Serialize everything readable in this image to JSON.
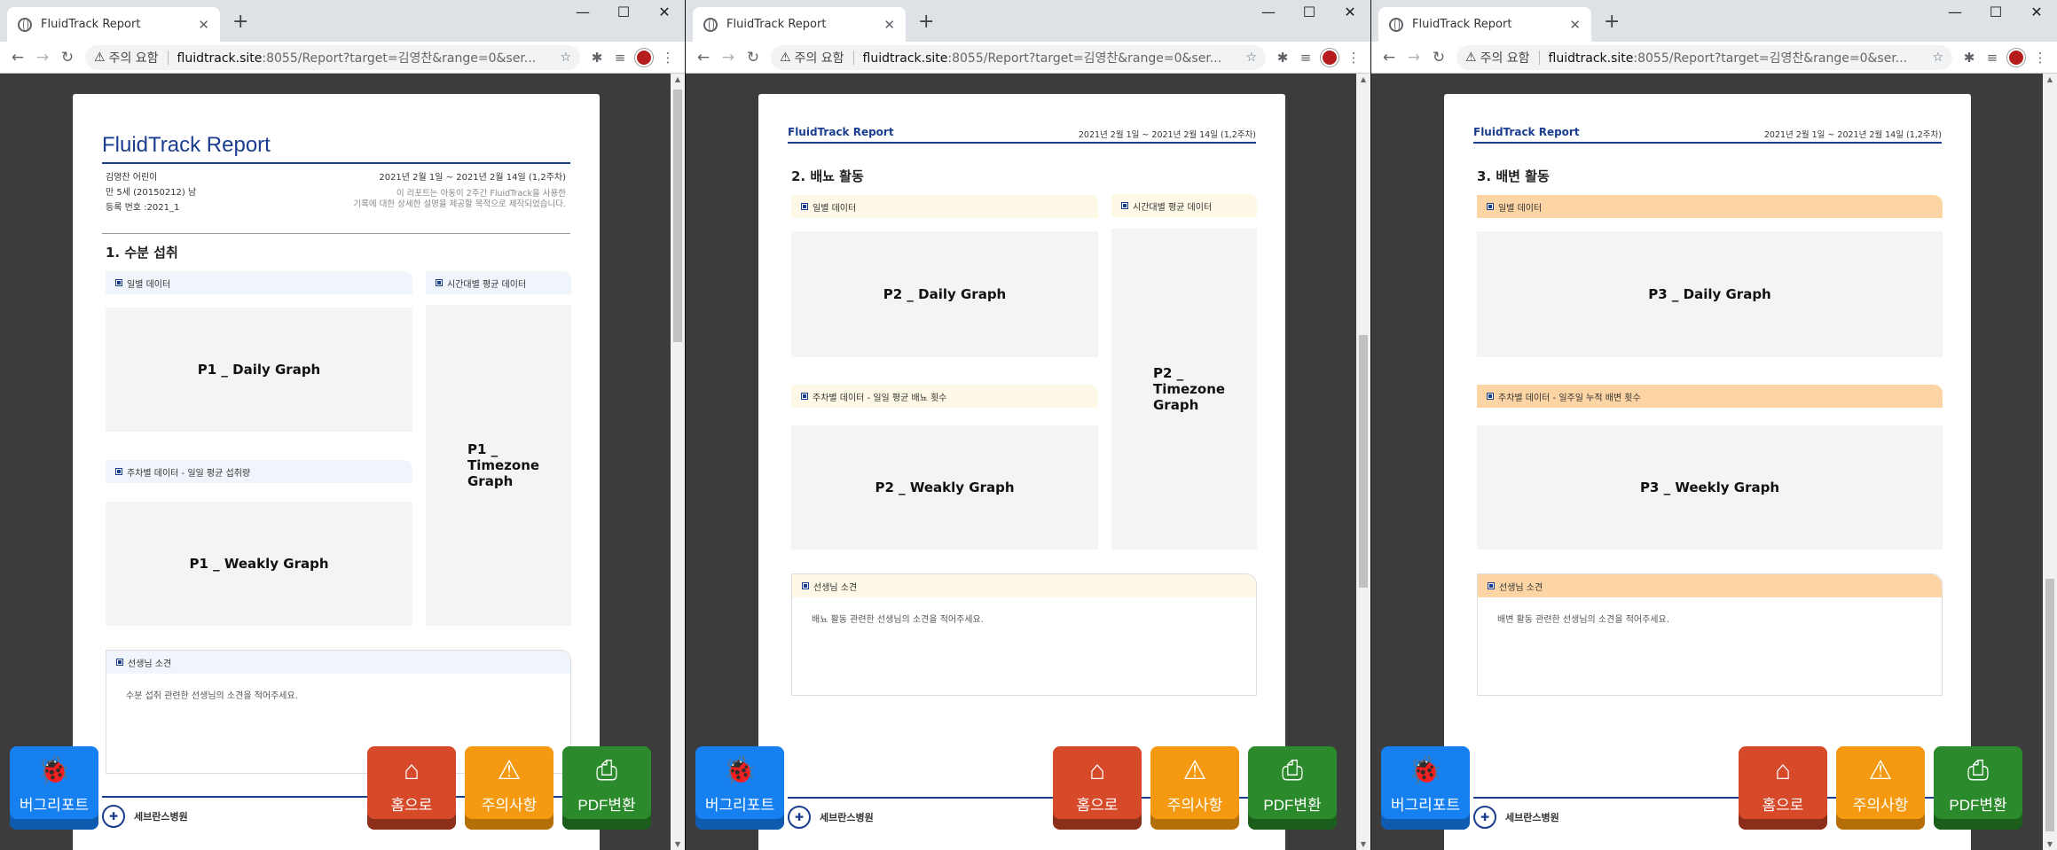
{
  "browser": {
    "tab_title": "FluidTrack Report",
    "tab_close": "✕",
    "new_tab": "+",
    "minimize": "—",
    "maximize": "☐",
    "close": "✕",
    "security_label": "주의 요함",
    "url_host": "fluidtrack.site",
    "url_rest": ":8055/Report?target=김영찬&range=0&ser..."
  },
  "report": {
    "title": "FluidTrack Report",
    "patient_name": "김영찬 어린이",
    "patient_age": "만 5세 (20150212) 남",
    "patient_id": "등록 번호 :2021_1",
    "date_range": "2021년 2월 1일 ~ 2021년 2월 14일 (1,2주차)",
    "note_line1": "이 리포트는 아동이 2주간 FluidTrack을 사용한",
    "note_line2": "기록에 대한 상세한 설명을 제공할 목적으로 제작되었습니다.",
    "mini_title": "FluidTrack Report",
    "hospital": "세브란스병원"
  },
  "page1": {
    "section_title": "1. 수분 섭취",
    "daily_label": "일별 데이터",
    "timezone_label": "시간대별 평균 데이터",
    "weekly_label": "주차별 데이터 - 일일 평균 섭취량",
    "daily_graph": "P1 _ Daily Graph",
    "weekly_graph": "P1 _ Weakly Graph",
    "timezone_graph": "P1 _ Timezone Graph",
    "comment_label": "선생님 소견",
    "comment_text": "수분 섭취 관련한 선생님의 소견을 적어주세요."
  },
  "page2": {
    "section_title": "2. 배뇨 활동",
    "daily_label": "일별 데이터",
    "timezone_label": "시간대별 평균 데이터",
    "weekly_label": "주차별 데이터 - 일일 평균 배뇨 횟수",
    "daily_graph": "P2 _ Daily Graph",
    "weekly_graph": "P2 _ Weakly Graph",
    "timezone_graph": "P2 _ Timezone Graph",
    "comment_label": "선생님 소견",
    "comment_text": "배뇨 활동 관련한 선생님의 소견을 적어주세요."
  },
  "page3": {
    "section_title": "3. 배변 활동",
    "daily_label": "일별 데이터",
    "weekly_label": "주차별 데이터 - 일주일 누적 배변 횟수",
    "daily_graph": "P3 _ Daily Graph",
    "weekly_graph": "P3 _ Weekly Graph",
    "comment_label": "선생님 소견",
    "comment_text": "배변 활동 관련한 선생님의 소견을 적어주세요."
  },
  "buttons": {
    "bug_report": "버그리포트",
    "home": "홈으로",
    "caution": "주의사항",
    "pdf": "PDF변환"
  },
  "colors": {
    "brand_blue": "#1a3d8f",
    "bug_button": "#1680f0",
    "home_button": "#d64a2a",
    "caution_button": "#f59a10",
    "pdf_button": "#2b8a2b"
  }
}
